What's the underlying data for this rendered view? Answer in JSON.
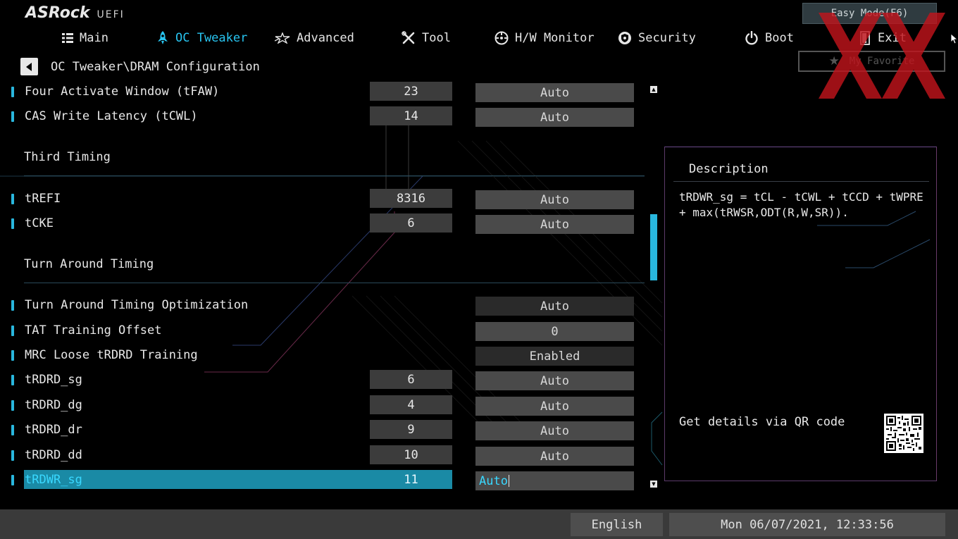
{
  "brand": {
    "name": "ASRock",
    "suffix": "UEFI"
  },
  "top_buttons": {
    "easy_mode": "Easy Mode(F6)",
    "my_favorite": "My Favorite"
  },
  "nav": [
    {
      "label": "Main",
      "icon": "list-icon",
      "active": false
    },
    {
      "label": "OC Tweaker",
      "icon": "rocket-icon",
      "active": true
    },
    {
      "label": "Advanced",
      "icon": "star-icon",
      "active": false
    },
    {
      "label": "Tool",
      "icon": "tools-icon",
      "active": false
    },
    {
      "label": "H/W Monitor",
      "icon": "gauge-icon",
      "active": false
    },
    {
      "label": "Security",
      "icon": "shield-icon",
      "active": false
    },
    {
      "label": "Boot",
      "icon": "power-icon",
      "active": false
    },
    {
      "label": "Exit",
      "icon": "exit-icon",
      "active": false
    }
  ],
  "breadcrumb": "OC Tweaker\\DRAM Configuration",
  "settings": [
    {
      "label": "Four Activate Window (tFAW)",
      "value": "23",
      "option": "Auto"
    },
    {
      "label": "CAS Write Latency (tCWL)",
      "value": "14",
      "option": "Auto"
    },
    {
      "section": "Third Timing"
    },
    {
      "label": "tREFI",
      "value": "8316",
      "option": "Auto"
    },
    {
      "label": "tCKE",
      "value": "6",
      "option": "Auto"
    },
    {
      "section": "Turn Around Timing"
    },
    {
      "label": "Turn Around Timing Optimization",
      "value": "",
      "option": "Auto"
    },
    {
      "label": "TAT Training Offset",
      "value": "",
      "option": "0"
    },
    {
      "label": "MRC Loose tRDRD Training",
      "value": "",
      "option": "Enabled"
    },
    {
      "label": "tRDRD_sg",
      "value": "6",
      "option": "Auto"
    },
    {
      "label": "tRDRD_dg",
      "value": "4",
      "option": "Auto"
    },
    {
      "label": "tRDRD_dr",
      "value": "9",
      "option": "Auto"
    },
    {
      "label": "tRDRD_dd",
      "value": "10",
      "option": "Auto"
    },
    {
      "label": "tRDWR_sg",
      "value": "11",
      "option": "Auto",
      "selected": true
    }
  ],
  "description": {
    "title": "Description",
    "text": "tRDWR_sg = tCL - tCWL + tCCD + tWPRE + max(tRWSR,ODT(R,W,SR)).",
    "qr_label": "Get details via QR code"
  },
  "footer": {
    "language": "English",
    "datetime": "Mon 06/07/2021, 12:33:56"
  },
  "colors": {
    "accent": "#29b7de",
    "selected_row": "#1a8aa5",
    "background": "#000000",
    "watermark": "#c0141c"
  }
}
